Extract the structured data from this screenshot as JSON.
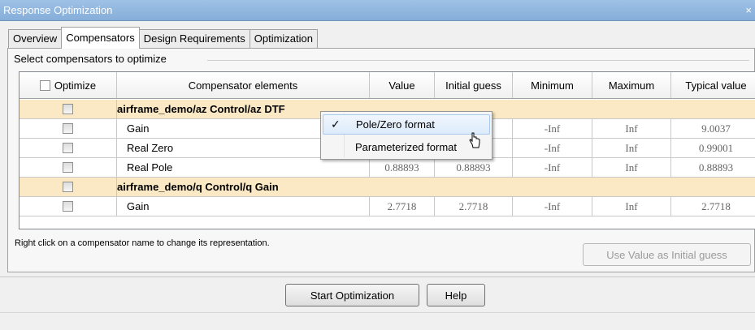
{
  "window": {
    "title": "Response Optimization",
    "close": "×"
  },
  "tabs": [
    "Overview",
    "Compensators",
    "Design Requirements",
    "Optimization"
  ],
  "panel": {
    "group_label": "Select compensators to optimize"
  },
  "table": {
    "headers": [
      "Optimize",
      "Compensator elements",
      "Value",
      "Initial guess",
      "Minimum",
      "Maximum",
      "Typical value"
    ],
    "rows": [
      {
        "type": "group",
        "label": "airframe_demo/az Control/az DTF"
      },
      {
        "type": "item",
        "label": "Gain",
        "value": "",
        "initial": "",
        "min": "-Inf",
        "max": "Inf",
        "typical": "9.0037"
      },
      {
        "type": "item",
        "label": "Real Zero",
        "value": "",
        "initial": "",
        "min": "-Inf",
        "max": "Inf",
        "typical": "0.99001"
      },
      {
        "type": "item",
        "label": "Real Pole",
        "value": "0.88893",
        "initial": "0.88893",
        "min": "-Inf",
        "max": "Inf",
        "typical": "0.88893"
      },
      {
        "type": "group",
        "label": "airframe_demo/q Control/q Gain"
      },
      {
        "type": "item",
        "label": "Gain",
        "value": "2.7718",
        "initial": "2.7718",
        "min": "-Inf",
        "max": "Inf",
        "typical": "2.7718"
      }
    ]
  },
  "context_menu": {
    "items": [
      {
        "label": "Pole/Zero format",
        "checked": true
      },
      {
        "label": "Parameterized format",
        "checked": false
      }
    ],
    "check_glyph": "✓"
  },
  "hint": "Right click on a compensator name to change its representation.",
  "buttons": {
    "use_value": "Use Value as Initial guess",
    "start": "Start Optimization",
    "help": "Help"
  }
}
